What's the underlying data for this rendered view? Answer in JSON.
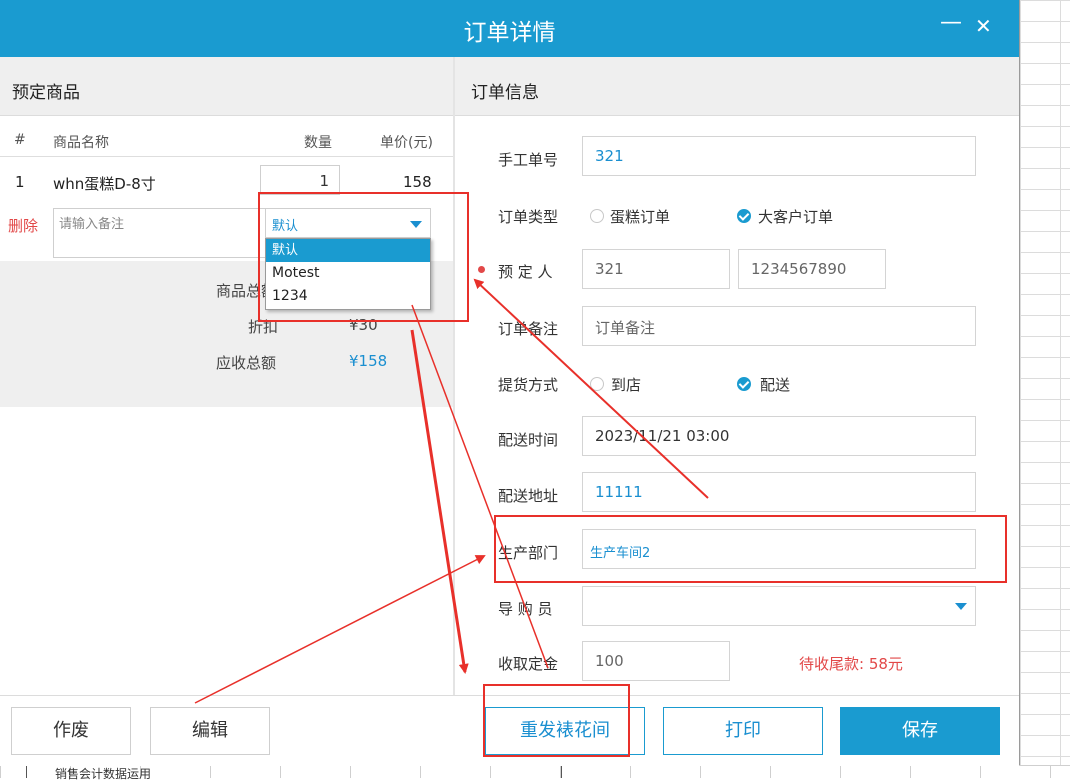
{
  "window": {
    "title": "订单详情",
    "minimize": "—",
    "close": "✕"
  },
  "left_panel": {
    "title": "预定商品",
    "columns": {
      "index": "#",
      "name": "商品名称",
      "qty": "数量",
      "price": "单价(元)"
    },
    "item": {
      "index": "1",
      "name": "whn蛋糕D-8寸",
      "qty": "1",
      "price": "158"
    },
    "delete_label": "删除",
    "note_placeholder": "请输入备注",
    "select_value": "默认",
    "select_options": [
      "默认",
      "Motest",
      "1234"
    ],
    "summary": {
      "total_label": "商品总额",
      "discount_label": "折扣",
      "discount_value": "¥30",
      "receivable_label": "应收总额",
      "receivable_value": "¥158"
    }
  },
  "right_panel": {
    "title": "订单信息",
    "manual_no_label": "手工单号",
    "manual_no_value": "321",
    "order_type_label": "订单类型",
    "order_type_options": [
      "蛋糕订单",
      "大客户订单"
    ],
    "booker_label": "预 定 人",
    "booker_name": "321",
    "booker_phone": "1234567890",
    "remark_label": "订单备注",
    "remark_placeholder": "订单备注",
    "pickup_label": "提货方式",
    "pickup_options": [
      "到店",
      "配送"
    ],
    "delivery_time_label": "配送时间",
    "delivery_time_value": "2023/11/21 03:00",
    "address_label": "配送地址",
    "address_value": "11111",
    "dept_label": "生产部门",
    "dept_value": "生产车间2",
    "guide_label": "导 购 员",
    "deposit_label": "收取定金",
    "deposit_value": "100",
    "remaining_label": "待收尾款: 58元"
  },
  "footer": {
    "void": "作废",
    "edit": "编辑",
    "resend": "重发裱花间",
    "print": "打印",
    "save": "保存"
  },
  "background": {
    "cell_text": "销售会计数据运用"
  },
  "colors": {
    "accent": "#1a9bd0",
    "danger": "#e24848",
    "annotation": "#e8302a"
  }
}
